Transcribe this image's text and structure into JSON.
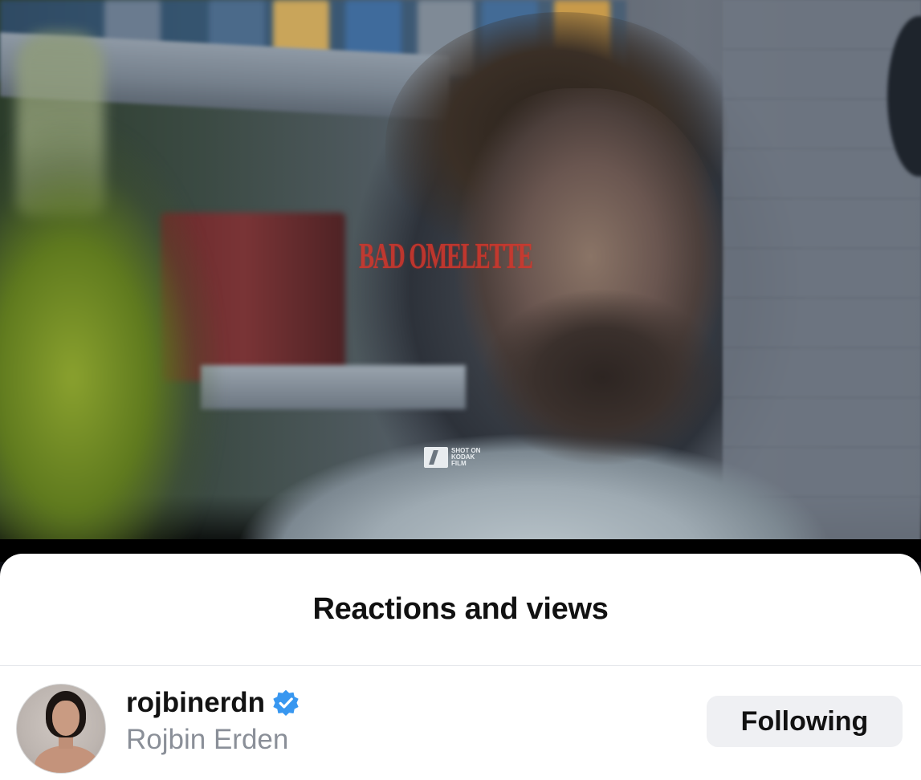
{
  "story": {
    "title_overlay": "BAD OMELETTE",
    "badge": [
      "SHOT ON",
      "KODAK",
      "FILM"
    ]
  },
  "sheet": {
    "title": "Reactions and views"
  },
  "viewers": [
    {
      "username": "rojbinerdn",
      "full_name": "Rojbin Erden",
      "verified": true,
      "button_label": "Following"
    }
  ],
  "colors": {
    "verified_blue": "#3897f0",
    "button_bg": "#eff0f3",
    "title_red": "#d6362b"
  },
  "icons": {
    "verified": "verified-badge-icon",
    "kodak": "kodak-logo-icon"
  }
}
